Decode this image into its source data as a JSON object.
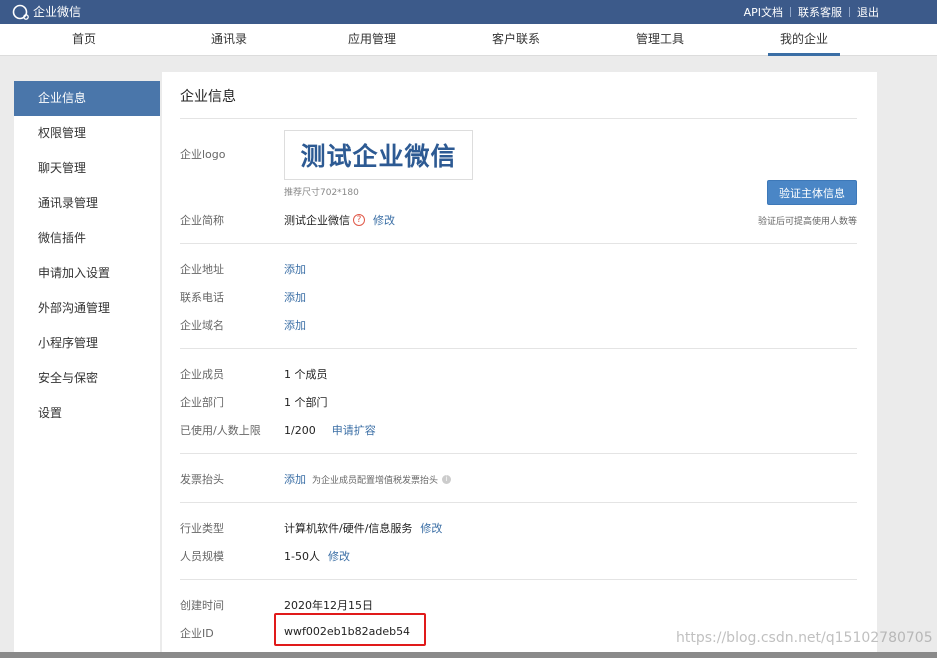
{
  "topbar": {
    "brand": "企业微信",
    "links": [
      "API文档",
      "联系客服",
      "退出"
    ]
  },
  "nav": {
    "items": [
      "首页",
      "通讯录",
      "应用管理",
      "客户联系",
      "管理工具",
      "我的企业"
    ],
    "active": "我的企业"
  },
  "sidebar": {
    "items": [
      "企业信息",
      "权限管理",
      "聊天管理",
      "通讯录管理",
      "微信插件",
      "申请加入设置",
      "外部沟通管理",
      "小程序管理",
      "安全与保密",
      "设置"
    ],
    "active": "企业信息"
  },
  "panel": {
    "title": "企业信息",
    "logo": {
      "label": "企业logo",
      "text": "测试企业微信",
      "hint": "推荐尺寸702*180"
    },
    "verify": {
      "button": "验证主体信息",
      "hint": "验证后可提高使用人数等"
    },
    "short_name": {
      "label": "企业简称",
      "value": "测试企业微信",
      "action": "修改"
    },
    "address": {
      "label": "企业地址",
      "action": "添加"
    },
    "phone": {
      "label": "联系电话",
      "action": "添加"
    },
    "domain": {
      "label": "企业域名",
      "action": "添加"
    },
    "members": {
      "label": "企业成员",
      "value": "1 个成员"
    },
    "departments": {
      "label": "企业部门",
      "value": "1 个部门"
    },
    "usage": {
      "label": "已使用/人数上限",
      "value": "1/200",
      "action": "申请扩容"
    },
    "invoice": {
      "label": "发票抬头",
      "action": "添加",
      "hint": "为企业成员配置增值税发票抬头"
    },
    "industry": {
      "label": "行业类型",
      "value": "计算机软件/硬件/信息服务",
      "action": "修改"
    },
    "scale": {
      "label": "人员规模",
      "value": "1-50人",
      "action": "修改"
    },
    "created": {
      "label": "创建时间",
      "value": "2020年12月15日"
    },
    "corp_id": {
      "label": "企业ID",
      "value": "wwf002eb1b82adeb54"
    }
  },
  "watermark": "https://blog.csdn.net/q15102780705",
  "colors": {
    "topbar": "#3c5a8a",
    "accent": "#4a76aa",
    "link": "#3a6ea5",
    "button": "#4a86c6",
    "highlight": "#e01a1a"
  }
}
